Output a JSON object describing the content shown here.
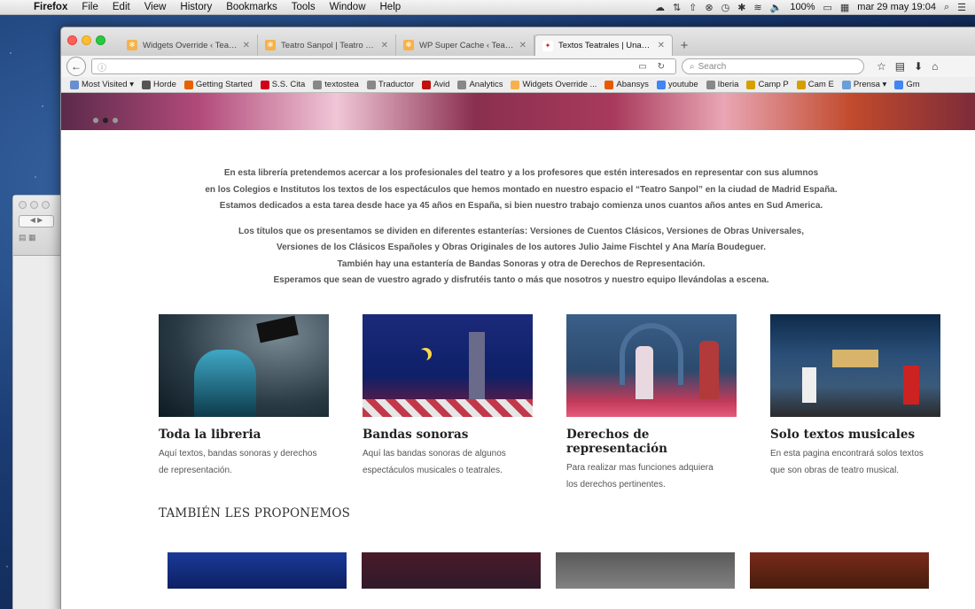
{
  "menubar": {
    "app": "Firefox",
    "items": [
      "File",
      "Edit",
      "View",
      "History",
      "Bookmarks",
      "Tools",
      "Window",
      "Help"
    ],
    "battery": "100%",
    "clock": "mar 29 may  19:04"
  },
  "tabs": [
    {
      "title": "Widgets Override ‹ Teatro ...",
      "active": false
    },
    {
      "title": "Teatro Sanpol | Teatro Sa...",
      "active": false
    },
    {
      "title": "WP Super Cache ‹ Teatro S...",
      "active": false
    },
    {
      "title": "Textos Teatrales | Una lib...",
      "active": true
    }
  ],
  "navbar": {
    "search_placeholder": "Search"
  },
  "bookmarks": [
    {
      "label": "Most Visited ▾",
      "color": "#6a8fd0"
    },
    {
      "label": "Horde",
      "color": "#555555"
    },
    {
      "label": "Getting Started",
      "color": "#e66000"
    },
    {
      "label": "S.S. Cita",
      "color": "#d0021b"
    },
    {
      "label": "textostea",
      "color": "#888888"
    },
    {
      "label": "Traductor",
      "color": "#888888"
    },
    {
      "label": "Avid",
      "color": "#c01010"
    },
    {
      "label": "Analytics",
      "color": "#888888"
    },
    {
      "label": "Widgets Override ...",
      "color": "#f6b24a"
    },
    {
      "label": "Abansys",
      "color": "#e85a00"
    },
    {
      "label": "youtube",
      "color": "#4285f4"
    },
    {
      "label": "Iberia",
      "color": "#888888"
    },
    {
      "label": "Camp P",
      "color": "#d4a000"
    },
    {
      "label": "Cam E",
      "color": "#d4a000"
    },
    {
      "label": "Prensa ▾",
      "color": "#6aa0d8"
    },
    {
      "label": "Gm",
      "color": "#4285f4"
    }
  ],
  "intro": {
    "p1": [
      "En esta librería pretendemos acercar a los profesionales del teatro y a los profesores que estén interesados en representar con sus alumnos",
      "en los Colegios e Institutos los textos de los espectáculos que hemos montado en nuestro espacio el “Teatro Sanpol” en la ciudad de Madrid España.",
      "Estamos dedicados a esta tarea desde hace ya 45 años en España, si bien nuestro trabajo comienza unos cuantos años antes en Sud America."
    ],
    "p2": [
      "Los títulos que os presentamos se dividen en diferentes estanterías: Versiones de Cuentos Clásicos, Versiones de Obras Universales,",
      "Versiones de los Clásicos Españoles y Obras Originales de los autores Julio Jaime Fischtel y Ana María Boudeguer.",
      "También hay una estantería de Bandas Sonoras y otra de Derechos de Representación.",
      "Esperamos que sean de vuestro agrado y disfrutéis tanto o más que nosotros y nuestro equipo llevándolas a escena."
    ]
  },
  "cards": [
    {
      "title": "Toda la libreria",
      "desc1": "Aquí textos, bandas sonoras y derechos",
      "desc2": "de representación."
    },
    {
      "title": "Bandas sonoras",
      "desc1": "Aquí las bandas sonoras de algunos",
      "desc2": "espectáculos musicales o teatrales."
    },
    {
      "title": "Derechos de representación",
      "desc1": "Para realizar mas funciones adquiera",
      "desc2": "los derechos pertinentes."
    },
    {
      "title": "Solo textos musicales",
      "desc1": "En esta pagina encontrará solos textos",
      "desc2": "que son obras de teatro musical."
    }
  ],
  "section_title": "TAMBIÉN LES PROPONEMOS"
}
